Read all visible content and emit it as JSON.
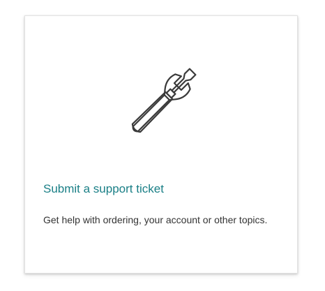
{
  "card": {
    "icon": "tools-icon",
    "title": "Submit a support ticket",
    "description": "Get help with ordering, your account or other topics.",
    "title_color": "#1a7f86",
    "text_color": "#333333"
  }
}
